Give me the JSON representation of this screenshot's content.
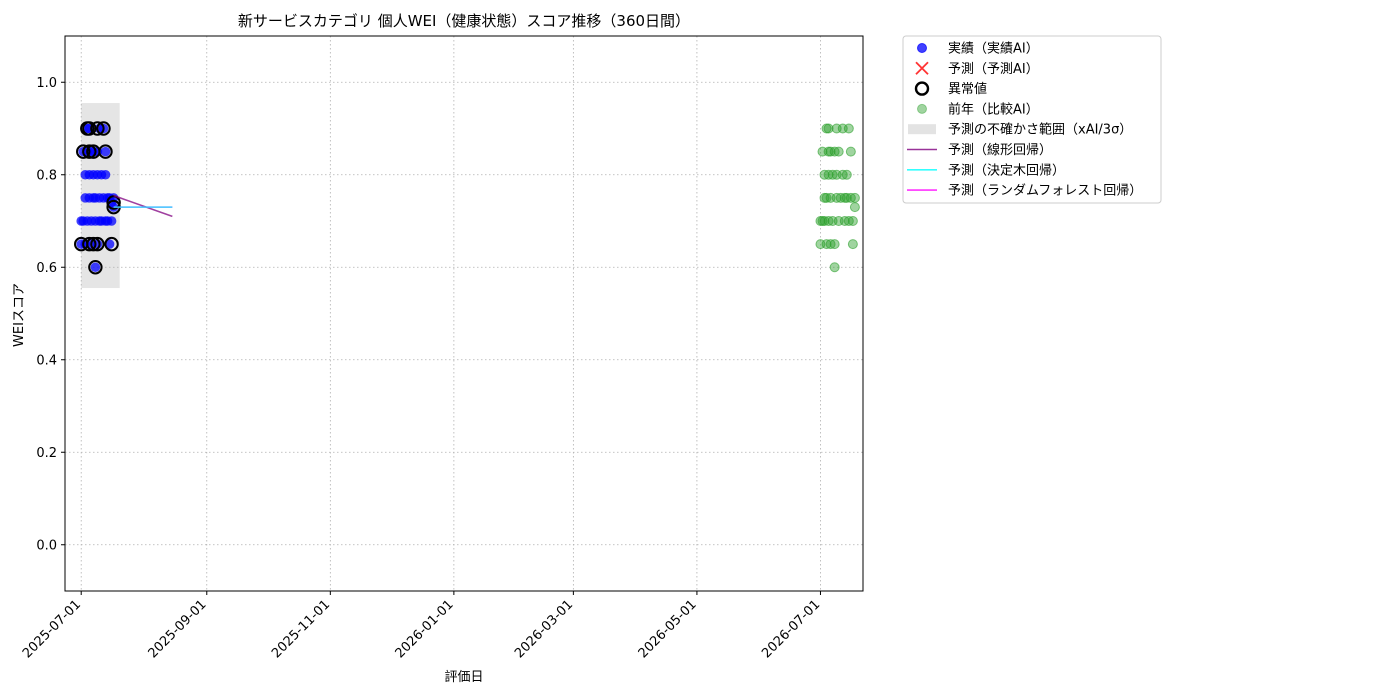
{
  "chart_data": {
    "type": "scatter",
    "title": "新サービスカテゴリ 個人WEI（健康状態）スコア推移（360日間）",
    "xlabel": "評価日",
    "ylabel": "WEIスコア",
    "xlim": [
      "2025-06-23",
      "2026-07-22"
    ],
    "ylim": [
      -0.1,
      1.1
    ],
    "xticks": [
      "2025-07-01",
      "2025-09-01",
      "2025-11-01",
      "2026-01-01",
      "2026-03-01",
      "2026-05-01",
      "2026-07-01"
    ],
    "yticks": [
      0.0,
      0.2,
      0.4,
      0.6,
      0.8,
      1.0
    ],
    "yticklabels": [
      "0.0",
      "0.2",
      "0.4",
      "0.6",
      "0.8",
      "1.0"
    ],
    "grid": true,
    "legend_position": "outside-right-top",
    "legend": [
      {
        "key": "actual",
        "label": "実績（実績AI）",
        "marker": "dot",
        "color": "#0000ff"
      },
      {
        "key": "forecast",
        "label": "予測（予測AI）",
        "marker": "x",
        "color": "#ff0000"
      },
      {
        "key": "outlier",
        "label": "異常値",
        "marker": "ring",
        "color": "#000000"
      },
      {
        "key": "prev_year",
        "label": "前年（比較AI）",
        "marker": "dot",
        "color": "#2ca02c"
      },
      {
        "key": "band",
        "label": "予測の不確かさ範囲（xAI/3σ）",
        "marker": "rect",
        "color": "#cccccc"
      },
      {
        "key": "linear",
        "label": "予測（線形回帰）",
        "marker": "line",
        "color": "#800080"
      },
      {
        "key": "tree",
        "label": "予測（決定木回帰）",
        "marker": "line",
        "color": "#00ffff"
      },
      {
        "key": "forest",
        "label": "予測（ランダムフォレスト回帰）",
        "marker": "line",
        "color": "#ff00ff"
      }
    ],
    "actual": [
      {
        "x": "2025-07-01",
        "y": 0.65
      },
      {
        "x": "2025-07-01",
        "y": 0.7
      },
      {
        "x": "2025-07-02",
        "y": 0.85
      },
      {
        "x": "2025-07-02",
        "y": 0.7
      },
      {
        "x": "2025-07-03",
        "y": 0.75
      },
      {
        "x": "2025-07-03",
        "y": 0.8
      },
      {
        "x": "2025-07-03",
        "y": 0.65
      },
      {
        "x": "2025-07-04",
        "y": 0.9
      },
      {
        "x": "2025-07-04",
        "y": 0.85
      },
      {
        "x": "2025-07-04",
        "y": 0.7
      },
      {
        "x": "2025-07-05",
        "y": 0.75
      },
      {
        "x": "2025-07-05",
        "y": 0.8
      },
      {
        "x": "2025-07-05",
        "y": 0.9
      },
      {
        "x": "2025-07-06",
        "y": 0.85
      },
      {
        "x": "2025-07-06",
        "y": 0.7
      },
      {
        "x": "2025-07-06",
        "y": 0.65
      },
      {
        "x": "2025-07-07",
        "y": 0.75
      },
      {
        "x": "2025-07-07",
        "y": 0.8
      },
      {
        "x": "2025-07-07",
        "y": 0.85
      },
      {
        "x": "2025-07-08",
        "y": 0.7
      },
      {
        "x": "2025-07-08",
        "y": 0.6
      },
      {
        "x": "2025-07-08",
        "y": 0.75
      },
      {
        "x": "2025-07-09",
        "y": 0.85
      },
      {
        "x": "2025-07-09",
        "y": 0.8
      },
      {
        "x": "2025-07-09",
        "y": 0.65
      },
      {
        "x": "2025-07-10",
        "y": 0.7
      },
      {
        "x": "2025-07-10",
        "y": 0.9
      },
      {
        "x": "2025-07-10",
        "y": 0.75
      },
      {
        "x": "2025-07-11",
        "y": 0.7
      },
      {
        "x": "2025-07-11",
        "y": 0.8
      },
      {
        "x": "2025-07-12",
        "y": 0.9
      },
      {
        "x": "2025-07-12",
        "y": 0.75
      },
      {
        "x": "2025-07-13",
        "y": 0.7
      },
      {
        "x": "2025-07-13",
        "y": 0.85
      },
      {
        "x": "2025-07-13",
        "y": 0.8
      },
      {
        "x": "2025-07-14",
        "y": 0.75
      },
      {
        "x": "2025-07-14",
        "y": 0.7
      },
      {
        "x": "2025-07-15",
        "y": 0.65
      },
      {
        "x": "2025-07-15",
        "y": 0.75
      },
      {
        "x": "2025-07-16",
        "y": 0.7
      },
      {
        "x": "2025-07-16",
        "y": 0.74
      },
      {
        "x": "2025-07-17",
        "y": 0.75
      },
      {
        "x": "2025-07-17",
        "y": 0.73
      }
    ],
    "outliers": [
      {
        "x": "2025-07-01",
        "y": 0.65
      },
      {
        "x": "2025-07-02",
        "y": 0.85
      },
      {
        "x": "2025-07-04",
        "y": 0.9
      },
      {
        "x": "2025-07-05",
        "y": 0.85
      },
      {
        "x": "2025-07-05",
        "y": 0.9
      },
      {
        "x": "2025-07-05",
        "y": 0.65
      },
      {
        "x": "2025-07-07",
        "y": 0.85
      },
      {
        "x": "2025-07-07",
        "y": 0.65
      },
      {
        "x": "2025-07-08",
        "y": 0.6
      },
      {
        "x": "2025-07-09",
        "y": 0.9
      },
      {
        "x": "2025-07-09",
        "y": 0.65
      },
      {
        "x": "2025-07-12",
        "y": 0.9
      },
      {
        "x": "2025-07-13",
        "y": 0.85
      },
      {
        "x": "2025-07-16",
        "y": 0.65
      },
      {
        "x": "2025-07-17",
        "y": 0.74
      },
      {
        "x": "2025-07-17",
        "y": 0.73
      }
    ],
    "uncertainty_band": {
      "x0": "2025-07-01",
      "x1": "2025-07-20",
      "y0": 0.555,
      "y1": 0.955
    },
    "forecast_lines": [
      {
        "key": "linear",
        "points": [
          {
            "x": "2025-07-17",
            "y": 0.755
          },
          {
            "x": "2025-08-15",
            "y": 0.71
          }
        ]
      },
      {
        "key": "forest",
        "points": [
          {
            "x": "2025-07-17",
            "y": 0.73
          },
          {
            "x": "2025-08-15",
            "y": 0.73
          }
        ]
      },
      {
        "key": "tree",
        "points": [
          {
            "x": "2025-07-17",
            "y": 0.73
          },
          {
            "x": "2025-08-15",
            "y": 0.73
          }
        ]
      }
    ],
    "prev_year": [
      {
        "x": "2026-07-01",
        "y": 0.65
      },
      {
        "x": "2026-07-01",
        "y": 0.7
      },
      {
        "x": "2026-07-02",
        "y": 0.7
      },
      {
        "x": "2026-07-02",
        "y": 0.85
      },
      {
        "x": "2026-07-03",
        "y": 0.75
      },
      {
        "x": "2026-07-03",
        "y": 0.8
      },
      {
        "x": "2026-07-03",
        "y": 0.7
      },
      {
        "x": "2026-07-04",
        "y": 0.9
      },
      {
        "x": "2026-07-04",
        "y": 0.65
      },
      {
        "x": "2026-07-04",
        "y": 0.75
      },
      {
        "x": "2026-07-05",
        "y": 0.85
      },
      {
        "x": "2026-07-05",
        "y": 0.7
      },
      {
        "x": "2026-07-05",
        "y": 0.8
      },
      {
        "x": "2026-07-05",
        "y": 0.9
      },
      {
        "x": "2026-07-06",
        "y": 0.65
      },
      {
        "x": "2026-07-06",
        "y": 0.75
      },
      {
        "x": "2026-07-06",
        "y": 0.85
      },
      {
        "x": "2026-07-07",
        "y": 0.8
      },
      {
        "x": "2026-07-07",
        "y": 0.7
      },
      {
        "x": "2026-07-08",
        "y": 0.65
      },
      {
        "x": "2026-07-08",
        "y": 0.6
      },
      {
        "x": "2026-07-08",
        "y": 0.85
      },
      {
        "x": "2026-07-09",
        "y": 0.75
      },
      {
        "x": "2026-07-09",
        "y": 0.8
      },
      {
        "x": "2026-07-09",
        "y": 0.9
      },
      {
        "x": "2026-07-10",
        "y": 0.7
      },
      {
        "x": "2026-07-10",
        "y": 0.85
      },
      {
        "x": "2026-07-11",
        "y": 0.75
      },
      {
        "x": "2026-07-12",
        "y": 0.8
      },
      {
        "x": "2026-07-12",
        "y": 0.9
      },
      {
        "x": "2026-07-13",
        "y": 0.75
      },
      {
        "x": "2026-07-13",
        "y": 0.7
      },
      {
        "x": "2026-07-14",
        "y": 0.8
      },
      {
        "x": "2026-07-14",
        "y": 0.75
      },
      {
        "x": "2026-07-15",
        "y": 0.9
      },
      {
        "x": "2026-07-15",
        "y": 0.7
      },
      {
        "x": "2026-07-16",
        "y": 0.85
      },
      {
        "x": "2026-07-16",
        "y": 0.75
      },
      {
        "x": "2026-07-17",
        "y": 0.65
      },
      {
        "x": "2026-07-17",
        "y": 0.7
      },
      {
        "x": "2026-07-18",
        "y": 0.75
      },
      {
        "x": "2026-07-18",
        "y": 0.73
      }
    ]
  }
}
